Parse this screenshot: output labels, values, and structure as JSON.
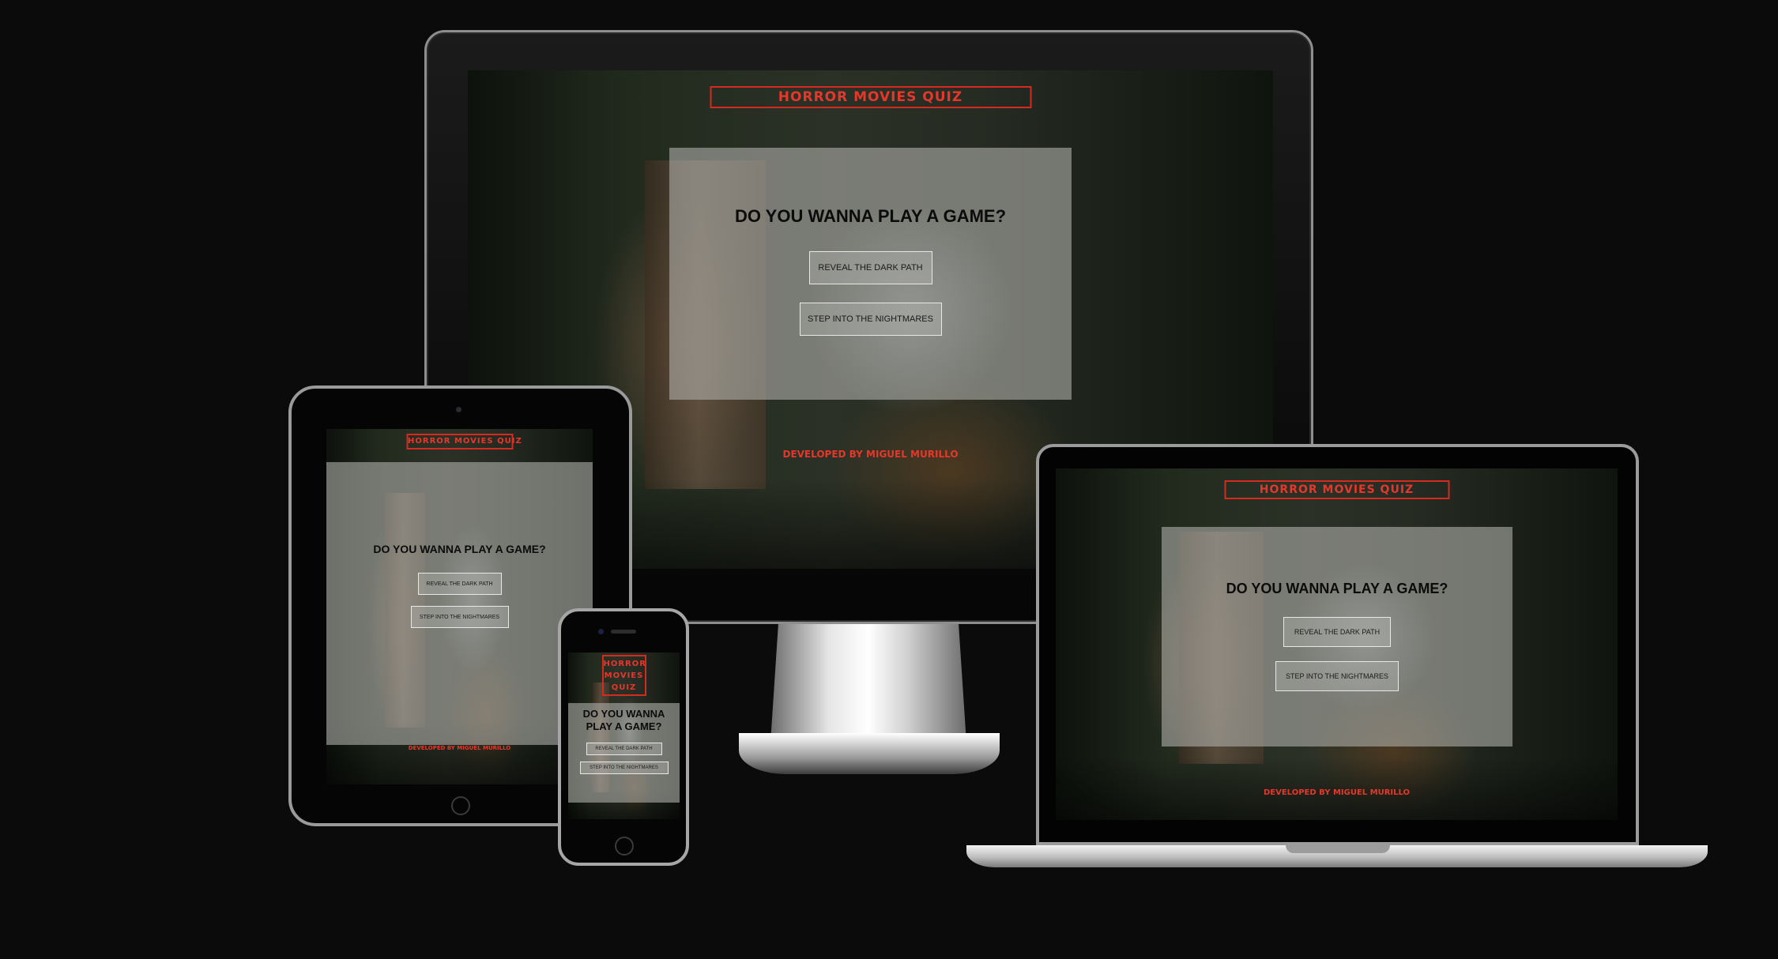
{
  "site": {
    "title": "HORROR MOVIES QUIZ",
    "title_mobile_lines": [
      "HORROR",
      "MOVIES",
      "QUIZ"
    ],
    "question": "DO YOU WANNA PLAY A GAME?",
    "question_mobile_lines": [
      "DO YOU WANNA",
      "PLAY A GAME?"
    ],
    "button_primary": "REVEAL THE DARK PATH",
    "button_secondary": "STEP INTO THE NIGHTMARES",
    "footer": "DEVELOPED BY MIGUEL MURILLO"
  },
  "colors": {
    "page_background": "#0b0b0b",
    "accent_red": "#e6372a",
    "card_overlay": "rgba(175,175,170,0.60)"
  },
  "devices": [
    "desktop-monitor",
    "tablet",
    "smartphone",
    "laptop"
  ]
}
